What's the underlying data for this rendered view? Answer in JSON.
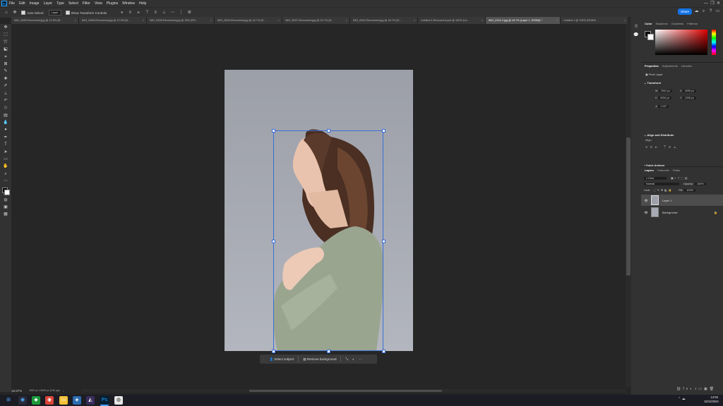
{
  "menubar": {
    "logo": "Ps",
    "items": [
      "File",
      "Edit",
      "Image",
      "Layer",
      "Type",
      "Select",
      "Filter",
      "View",
      "Plugins",
      "Window",
      "Help"
    ]
  },
  "options": {
    "auto_select": "Auto-Select:",
    "target": "Layer",
    "show_transform": "Show Transform Controls",
    "share": "Share"
  },
  "tabs": [
    {
      "label": "IMG_0483-Recovered.jpg @ 12.5% (B..."
    },
    {
      "label": "IMG_0485-Recovered.jpg @ 12.5% (B..."
    },
    {
      "label": "IMG_0526-Recovered.jpg @ 25% (RG..."
    },
    {
      "label": "IMG_0534-Recovered.jpg @ 16.7% (R..."
    },
    {
      "label": "IMG_0537-Recovered.jpg @ 16.7% (R..."
    },
    {
      "label": "IMG_0542-Recovered.jpg @ 16.7% (R..."
    },
    {
      "label": "Untitled-2-Recovered.psd @ 100% (La..."
    },
    {
      "label": "IMG_0114-2.jpg @ 16.7% (Layer 1, RGB/8) *"
    },
    {
      "label": "Untitled-1 @ 100% (RGB/8..."
    }
  ],
  "context_bar": {
    "select_subject": "Select subject",
    "remove_background": "Remove background"
  },
  "status": {
    "zoom": "16.67%",
    "doc_size": "4000 px x 6000 px (240 ppi)"
  },
  "color_panel": {
    "tabs": [
      "Color",
      "Swatches",
      "Gradients",
      "Patterns"
    ]
  },
  "properties": {
    "tabs": [
      "Properties",
      "Adjustments",
      "Libraries"
    ],
    "layer_kind": "Pixel Layer",
    "transform_title": "Transform",
    "w": "2961 px",
    "h": "4034 px",
    "x": "4095 px",
    "y": "1306 px",
    "angle": "0.00°",
    "align_title": "Align and Distribute",
    "align_label": "Align:",
    "quick_actions": "Quick Actions"
  },
  "layers": {
    "tabs": [
      "Layers",
      "Channels",
      "Paths"
    ],
    "kind": "Kind",
    "blend": "Normal",
    "opacity_label": "Opacity:",
    "opacity": "100%",
    "lock_label": "Lock:",
    "fill_label": "Fill:",
    "fill": "100%",
    "items": [
      {
        "name": "Layer 1",
        "selected": true
      },
      {
        "name": "Background",
        "selected": false
      }
    ]
  },
  "clock": {
    "time": "14:53",
    "date": "15/11/2024"
  },
  "colors": {
    "accent": "#1473e6",
    "selection": "#3a6fd6"
  }
}
